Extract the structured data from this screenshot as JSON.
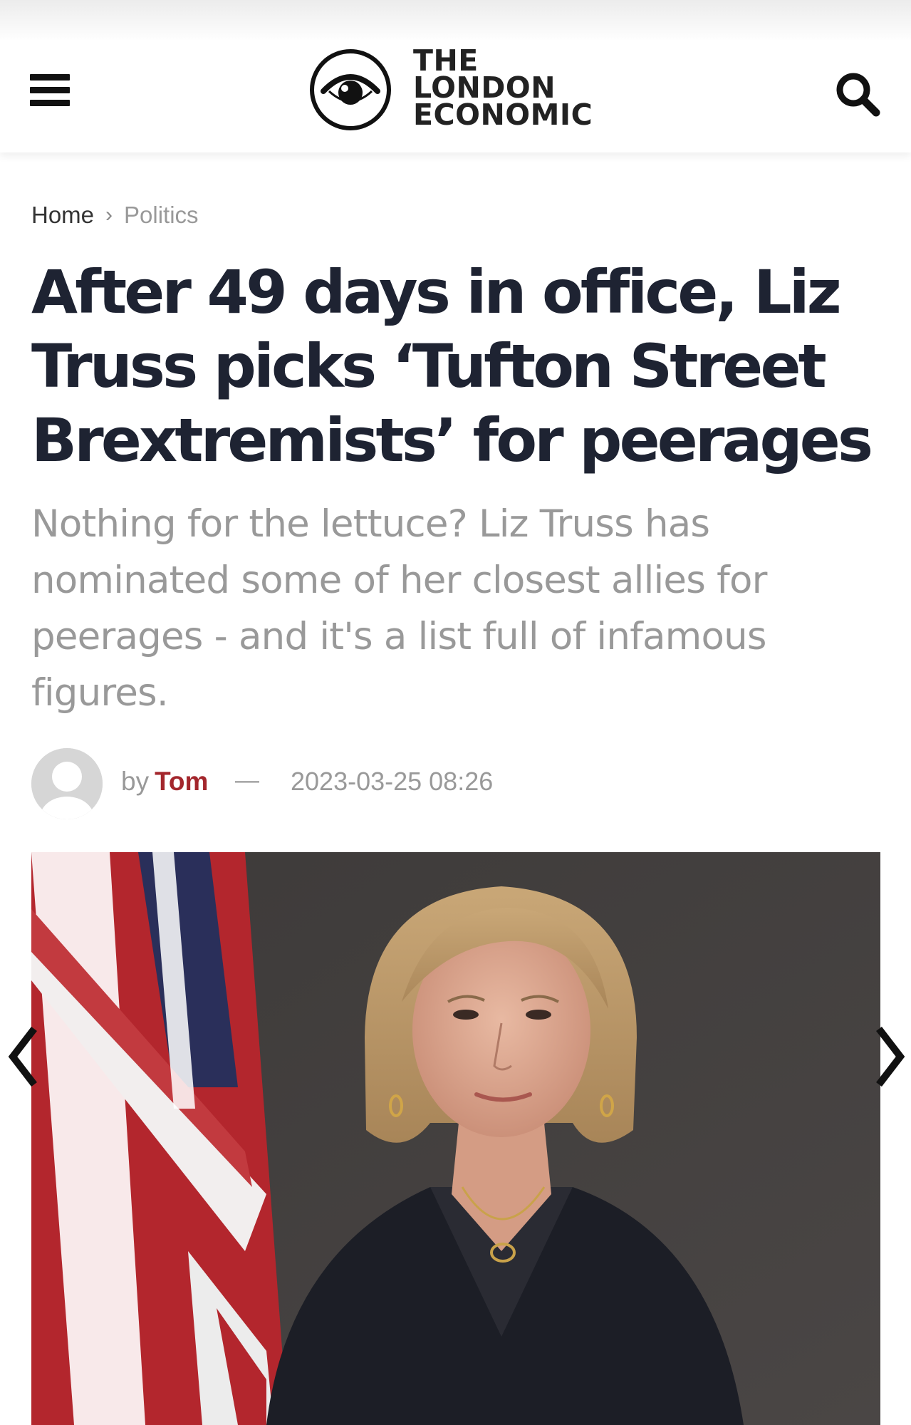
{
  "header": {
    "logo_line1": "THE",
    "logo_line2": "LONDON",
    "logo_line3": "ECONOMIC",
    "menu_icon": "hamburger-menu-icon",
    "search_icon": "search-icon"
  },
  "breadcrumb": {
    "home": "Home",
    "separator": "›",
    "current": "Politics"
  },
  "article": {
    "headline": "After 49 days in office, Liz Truss picks ‘Tufton Street Brextremists’ for peerages",
    "subtitle": "Nothing for the lettuce? Liz Truss has nominated some of her closest allies for peerages - and it's a list full of infamous figures.",
    "by_label": "by",
    "author": "Tom",
    "dash": "—",
    "date": "2023-03-25 08:26"
  },
  "gallery": {
    "prev_icon": "chevron-left-icon",
    "next_icon": "chevron-right-icon"
  },
  "colors": {
    "headline": "#1e2332",
    "muted": "#999999",
    "author": "#a3262c"
  }
}
